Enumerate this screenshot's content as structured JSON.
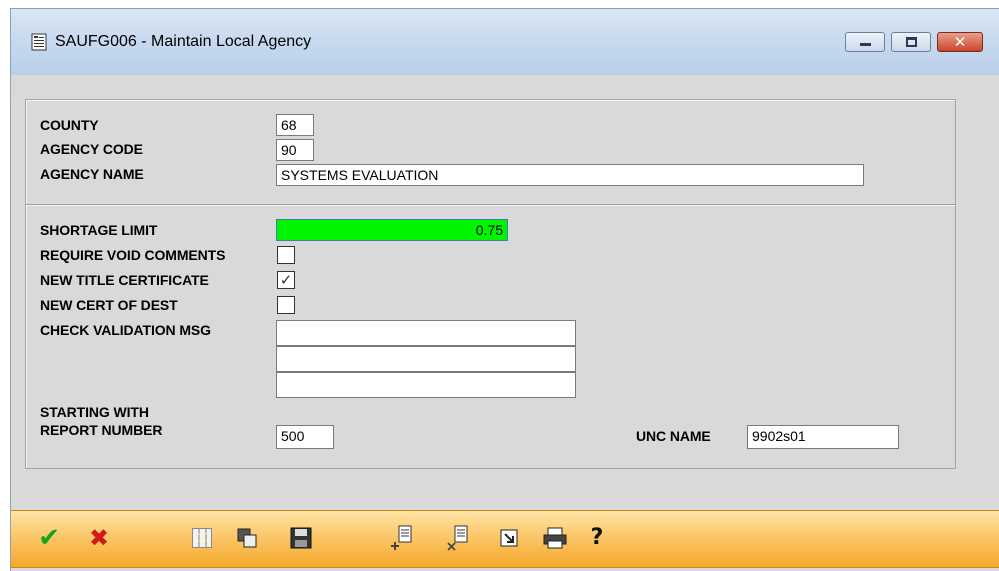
{
  "window": {
    "title": "SAUFG006 - Maintain Local Agency",
    "close_symbol": "✕"
  },
  "form": {
    "county": {
      "label": "COUNTY",
      "value": "68"
    },
    "agency_code": {
      "label": "AGENCY CODE",
      "value": "90"
    },
    "agency_name": {
      "label": "AGENCY NAME",
      "value": "SYSTEMS EVALUATION"
    },
    "shortage_limit": {
      "label": "SHORTAGE LIMIT",
      "value": "0.75",
      "highlight_color": "#00f500"
    },
    "require_void_comments": {
      "label": "REQUIRE VOID COMMENTS",
      "checked": false,
      "mark": ""
    },
    "new_title_certificate": {
      "label": "NEW TITLE CERTIFICATE",
      "checked": true,
      "mark": "✓"
    },
    "new_cert_of_dest": {
      "label": "NEW CERT OF DEST",
      "checked": false,
      "mark": ""
    },
    "check_validation_msg": {
      "label": "CHECK VALIDATION MSG",
      "lines": [
        "",
        "",
        ""
      ]
    },
    "starting_with_label": "STARTING WITH",
    "report_number": {
      "label": "REPORT NUMBER",
      "value": "500"
    },
    "unc_name": {
      "label": "UNC NAME",
      "value": "9902s01"
    }
  },
  "toolbar": {
    "accent": "#f5a82c",
    "ok_symbol": "✔",
    "cancel_symbol": "✖",
    "help_symbol": "?",
    "icons": [
      "ok-icon",
      "cancel-icon",
      "grid-icon",
      "copy-icon",
      "save-icon",
      "insert-row-icon",
      "delete-row-icon",
      "export-icon",
      "print-icon",
      "help-icon"
    ]
  }
}
